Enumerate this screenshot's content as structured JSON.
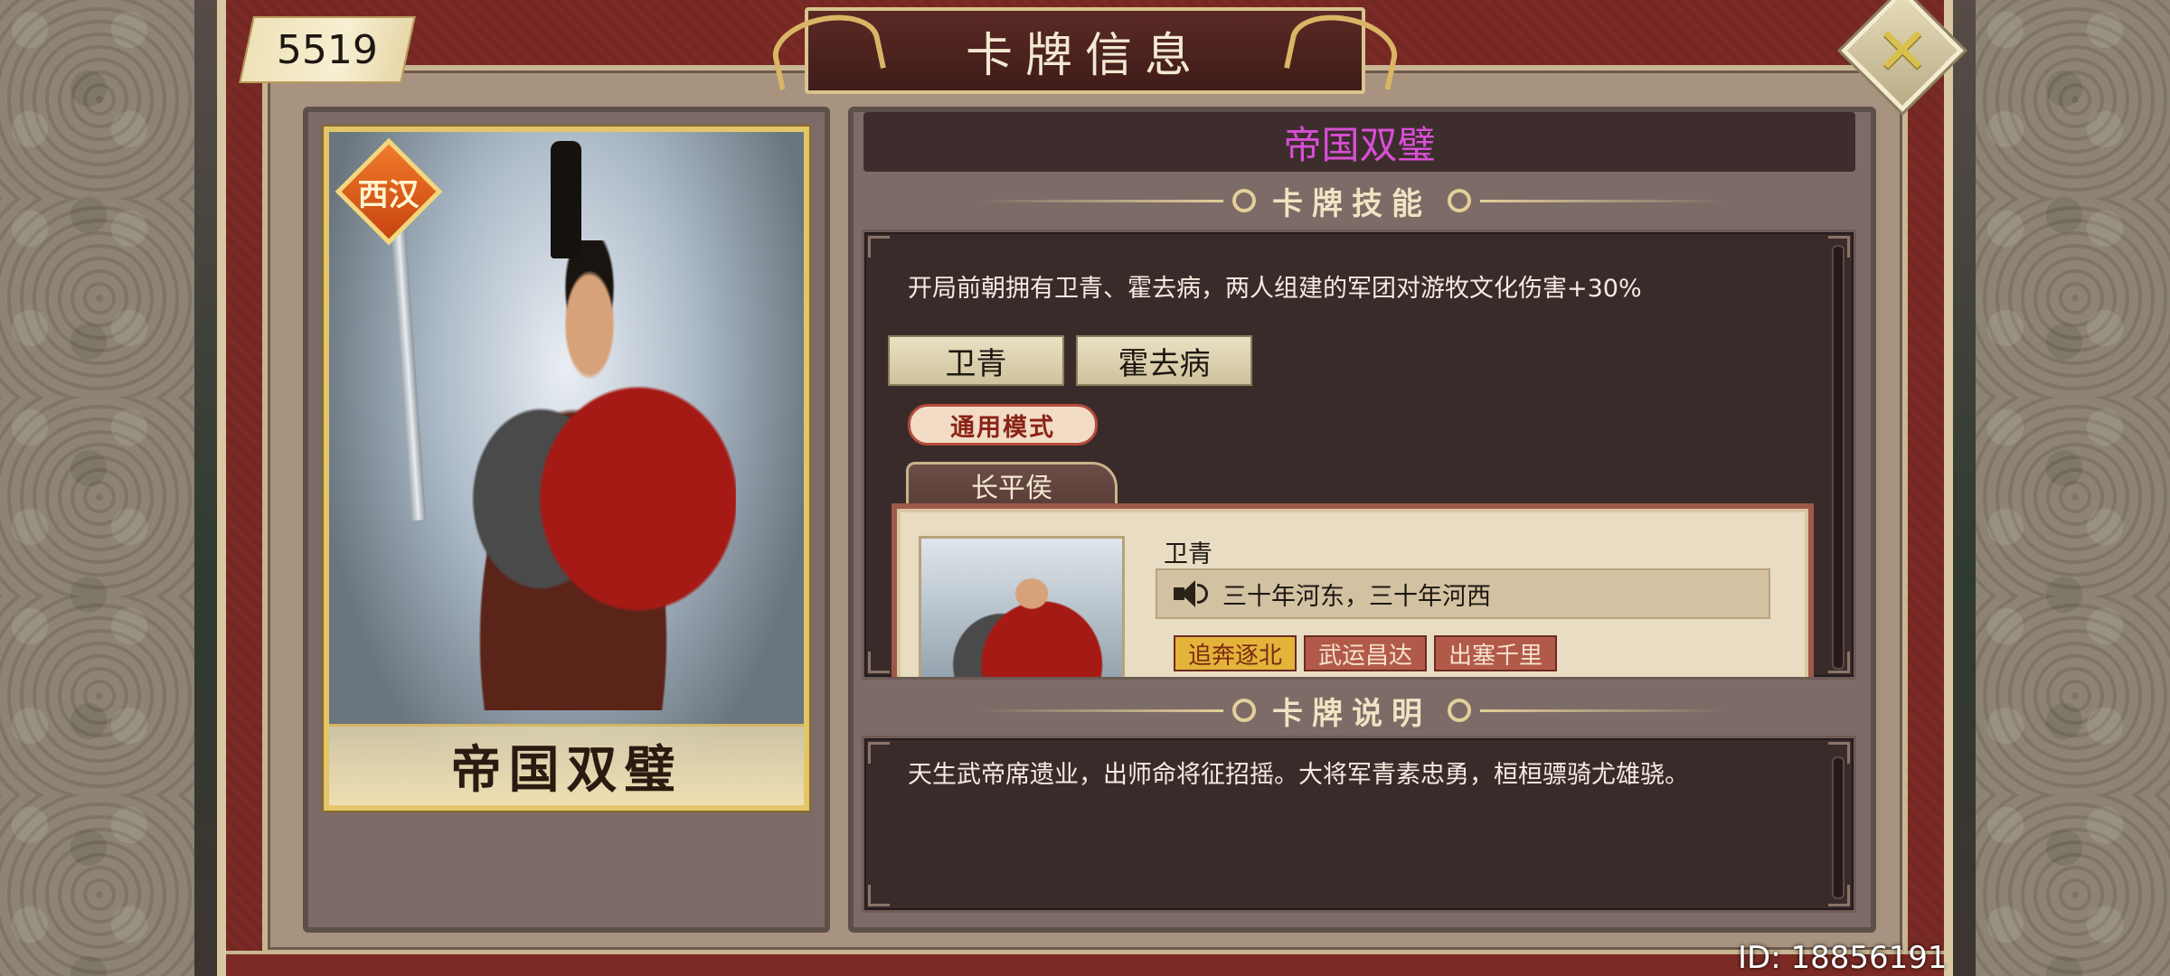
{
  "header": {
    "currency_amount": "5519",
    "title": "卡牌信息",
    "close_icon": "close-x-icon"
  },
  "card": {
    "name": "帝国双璧",
    "dynasty_badge": "西汉",
    "art_icon": "general-portrait-image"
  },
  "info": {
    "card_title": "帝国双璧",
    "card_title_color": "#d94fd6",
    "skills_section_label": "卡牌技能",
    "skill_description": "开局前朝拥有卫青、霍去病，两人组建的军团对游牧文化伤害+30%",
    "hero_buttons": [
      "卫青",
      "霍去病"
    ],
    "mode_tag": "通用模式",
    "title_tab": "长平侯",
    "dialog": {
      "speaker": "卫青",
      "quote": "三十年河东，三十年河西",
      "speaker_icon": "speaker-icon",
      "tags": [
        "追奔逐北",
        "武运昌达",
        "出塞千里"
      ]
    },
    "description_section_label": "卡牌说明",
    "description": "天生武帝席遗业，出师命将征招摇。大将军青素忠勇，桓桓骠骑尤雄骁。"
  },
  "footer": {
    "player_id": "ID: 18856191"
  }
}
